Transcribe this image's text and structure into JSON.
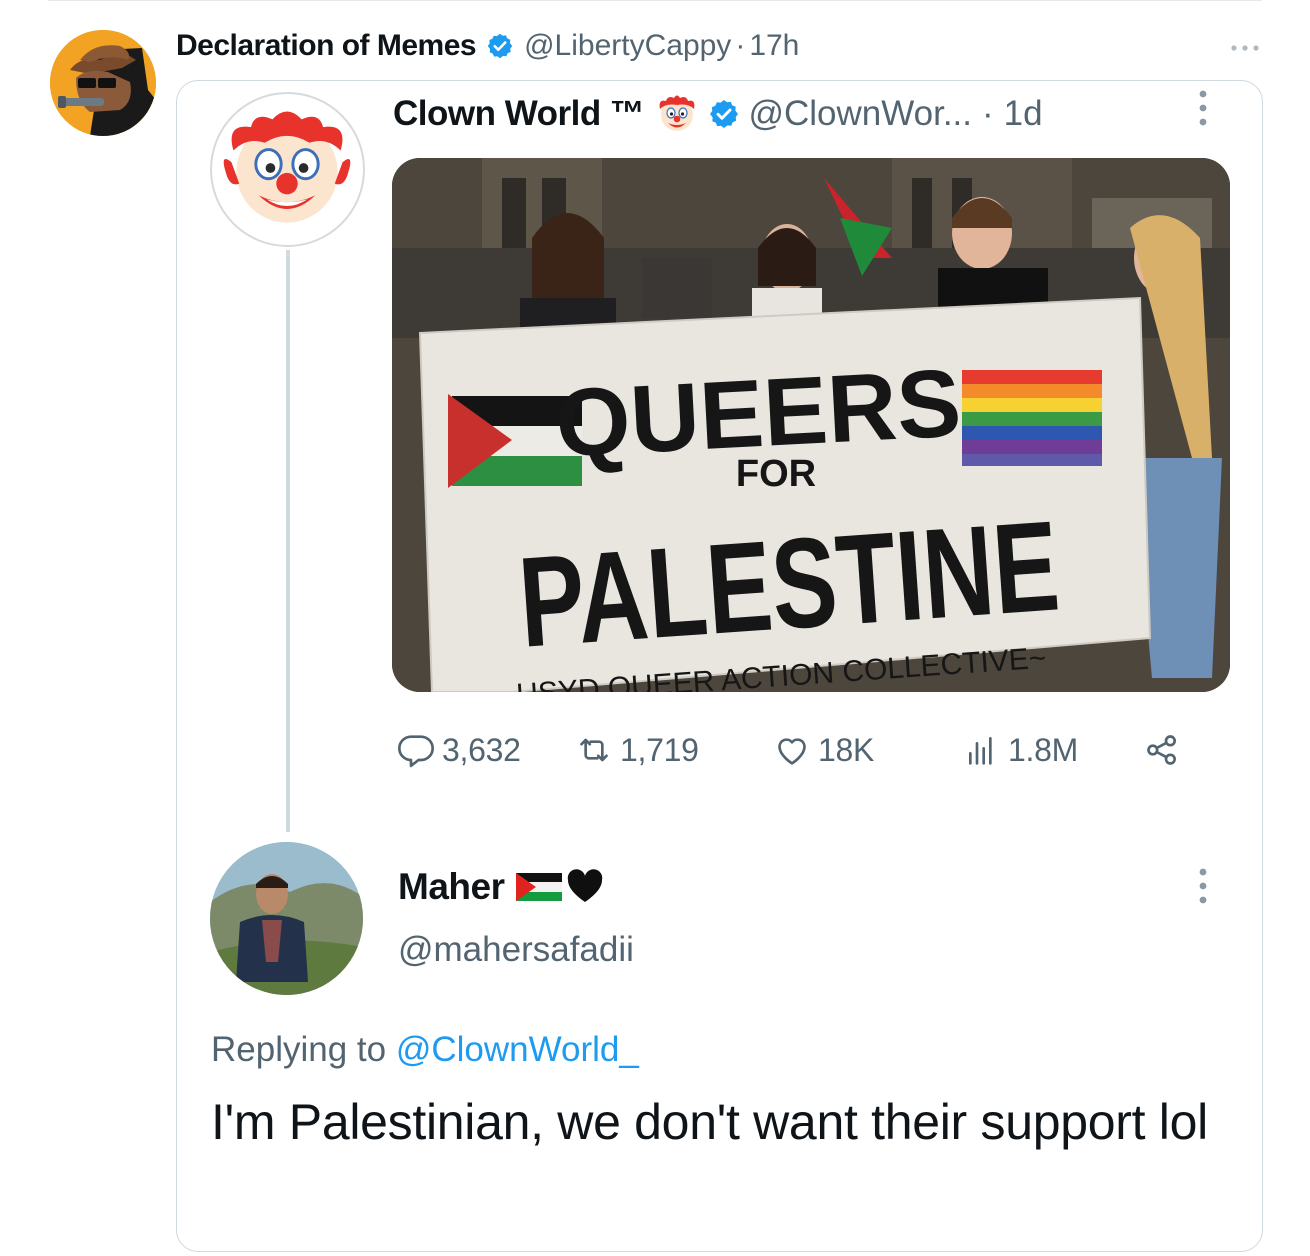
{
  "outer_tweet": {
    "display_name": "Declaration of Memes",
    "handle": "@LibertyCappy",
    "separator": "·",
    "time": "17h",
    "avatar_icon": "cowboy-horse-avatar-icon",
    "verified_icon": "verified-badge-icon",
    "more_icon": "more-horizontal-icon"
  },
  "quoted_tweet": {
    "display_name": "Clown World ™",
    "handle": "@ClownWor...",
    "separator": "·",
    "time": "1d",
    "name_emoji": "clown-face-icon",
    "avatar_icon": "clown-face-icon",
    "more_icon": "more-vertical-icon",
    "photo": {
      "banner_line1": "QUEERS",
      "banner_line2": "FOR",
      "banner_line3": "PALESTINE",
      "banner_footer": "USYD QUEER ACTION COLLECTIVE~"
    },
    "actions": {
      "replies": "3,632",
      "retweets": "1,719",
      "likes": "18K",
      "views": "1.8M"
    }
  },
  "reply": {
    "display_name": "Maher",
    "name_emojis": [
      "palestine-flag-icon",
      "black-heart-icon"
    ],
    "handle": "@mahersafadii",
    "replying_prefix": "Replying to",
    "replying_to": "@ClownWorld_",
    "text": "I'm Palestinian, we don't want their support lol",
    "more_icon": "more-vertical-icon"
  },
  "colors": {
    "verified_blue": "#1d9bf0",
    "secondary_text": "#536471",
    "link_blue": "#1d9bf0",
    "border": "#cfd9de"
  }
}
